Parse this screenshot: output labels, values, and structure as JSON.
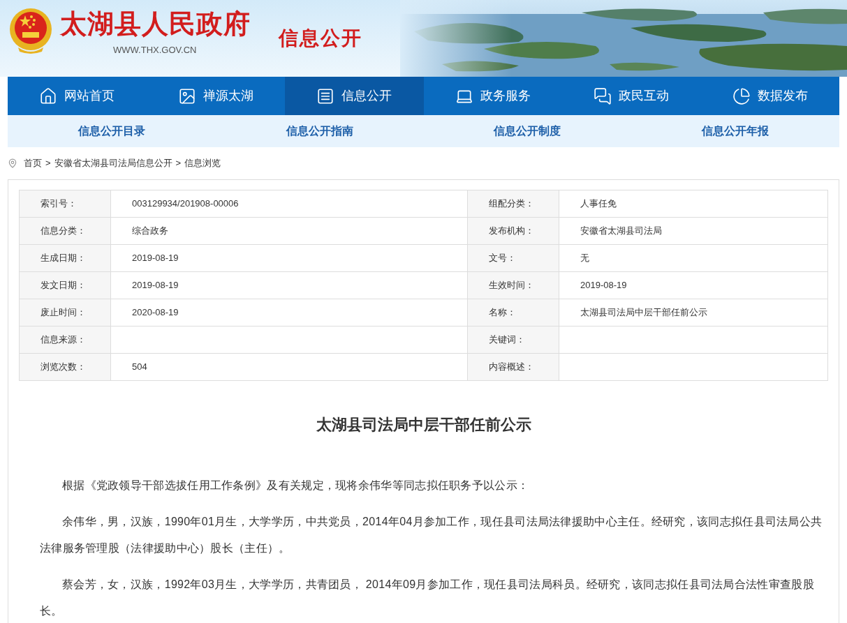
{
  "header": {
    "title": "太湖县人民政府",
    "url": "WWW.THX.GOV.CN",
    "section": "信息公开"
  },
  "nav": [
    {
      "label": "网站首页",
      "selected": false
    },
    {
      "label": "禅源太湖",
      "selected": false
    },
    {
      "label": "信息公开",
      "selected": true
    },
    {
      "label": "政务服务",
      "selected": false
    },
    {
      "label": "政民互动",
      "selected": false
    },
    {
      "label": "数据发布",
      "selected": false
    }
  ],
  "subnav": [
    "信息公开目录",
    "信息公开指南",
    "信息公开制度",
    "信息公开年报"
  ],
  "breadcrumb": [
    "首页",
    "安徽省太湖县司法局信息公开",
    "信息浏览"
  ],
  "breadcrumb_separator": ">",
  "info_table": [
    [
      {
        "label": "索引号：",
        "value": "003129934/201908-00006"
      },
      {
        "label": "组配分类：",
        "value": "人事任免"
      }
    ],
    [
      {
        "label": "信息分类：",
        "value": "综合政务"
      },
      {
        "label": "发布机构：",
        "value": "安徽省太湖县司法局"
      }
    ],
    [
      {
        "label": "生成日期：",
        "value": "2019-08-19"
      },
      {
        "label": "文号：",
        "value": "无"
      }
    ],
    [
      {
        "label": "发文日期：",
        "value": "2019-08-19"
      },
      {
        "label": "生效时间：",
        "value": "2019-08-19"
      }
    ],
    [
      {
        "label": "废止时间：",
        "value": "2020-08-19"
      },
      {
        "label": "名称：",
        "value": "太湖县司法局中层干部任前公示"
      }
    ],
    [
      {
        "label": "信息来源："
      },
      {
        "label": "关键词："
      }
    ],
    [
      {
        "label": "浏览次数：",
        "value": "504"
      },
      {
        "label": "内容概述："
      }
    ]
  ],
  "article": {
    "title": "太湖县司法局中层干部任前公示",
    "paragraphs": [
      "根据《党政领导干部选拔任用工作条例》及有关规定，现将余伟华等同志拟任职务予以公示：",
      "余伟华，男，汉族，1990年01月生，大学学历，中共党员，2014年04月参加工作，现任县司法局法律援助中心主任。经研究，该同志拟任县司法局公共法律服务管理股（法律援助中心）股长（主任）。",
      "蔡会芳，女，汉族，1992年03月生，大学学历，共青团员， 2014年09月参加工作，现任县司法局科员。经研究，该同志拟任县司法局合法性审查股股长。"
    ]
  }
}
